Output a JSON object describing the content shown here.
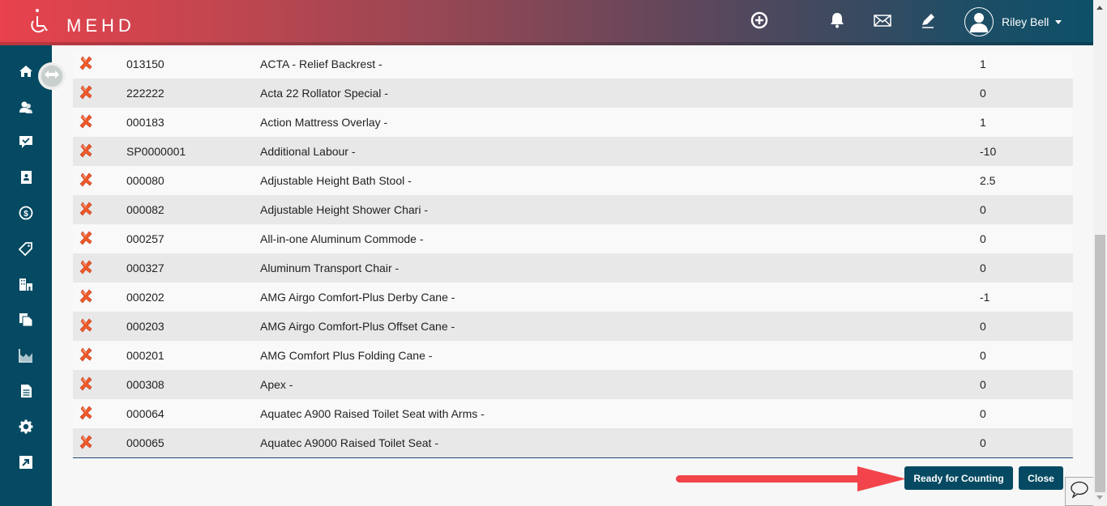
{
  "header": {
    "app_name": "MEHD",
    "logo_icon": "wheelchair-icon",
    "icons": [
      "add-circle-icon",
      "bell-icon",
      "envelope-icon",
      "pencil-icon"
    ],
    "user": {
      "name": "Riley Bell",
      "avatar_icon": "user-avatar-icon"
    }
  },
  "sidebar": {
    "items": [
      {
        "name": "home",
        "icon": "home-icon"
      },
      {
        "name": "clients",
        "icon": "users-icon"
      },
      {
        "name": "tasks",
        "icon": "chat-check-icon"
      },
      {
        "name": "contacts",
        "icon": "contact-book-icon"
      },
      {
        "name": "billing",
        "icon": "dollar-icon"
      },
      {
        "name": "products",
        "icon": "tag-icon"
      },
      {
        "name": "facilities",
        "icon": "building-icon"
      },
      {
        "name": "documents",
        "icon": "copy-icon"
      },
      {
        "name": "reports",
        "icon": "chart-icon"
      },
      {
        "name": "forms",
        "icon": "file-text-icon"
      },
      {
        "name": "settings",
        "icon": "gear-icon"
      },
      {
        "name": "external",
        "icon": "external-link-icon"
      }
    ],
    "toggle_icon": "expand-arrows-icon"
  },
  "table": {
    "rows": [
      {
        "code": "013150",
        "description": "ACTA - Relief Backrest -",
        "qty": "1"
      },
      {
        "code": "222222",
        "description": "Acta 22 Rollator Special -",
        "qty": "0"
      },
      {
        "code": "000183",
        "description": "Action Mattress Overlay -",
        "qty": "1"
      },
      {
        "code": "SP0000001",
        "description": "Additional Labour -",
        "qty": "-10"
      },
      {
        "code": "000080",
        "description": "Adjustable Height Bath Stool -",
        "qty": "2.5"
      },
      {
        "code": "000082",
        "description": "Adjustable Height Shower Chari -",
        "qty": "0"
      },
      {
        "code": "000257",
        "description": "All-in-one Aluminum Commode -",
        "qty": "0"
      },
      {
        "code": "000327",
        "description": "Aluminum Transport Chair -",
        "qty": "0"
      },
      {
        "code": "000202",
        "description": "AMG Airgo Comfort-Plus Derby Cane -",
        "qty": "-1"
      },
      {
        "code": "000203",
        "description": "AMG Airgo Comfort-Plus Offset Cane -",
        "qty": "0"
      },
      {
        "code": "000201",
        "description": "AMG Comfort Plus Folding Cane -",
        "qty": "0"
      },
      {
        "code": "000308",
        "description": "Apex -",
        "qty": "0"
      },
      {
        "code": "000064",
        "description": "Aquatec A900 Raised Toilet Seat with Arms -",
        "qty": "0"
      },
      {
        "code": "000065",
        "description": "Aquatec A9000 Raised Toilet Seat -",
        "qty": "0"
      }
    ]
  },
  "actions": {
    "ready_label": "Ready for Counting",
    "close_label": "Close"
  },
  "colors": {
    "sidebar": "#054a62",
    "button": "#054a62",
    "annotation_arrow": "#f2444a",
    "delete_icon": "#f05a28"
  }
}
